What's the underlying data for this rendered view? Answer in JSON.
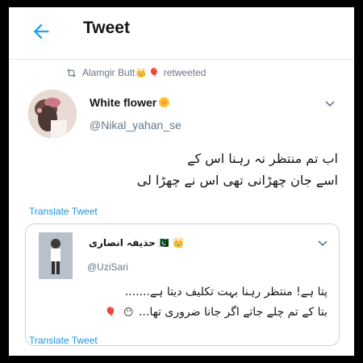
{
  "header": {
    "title": "Tweet",
    "back_icon": "back-arrow-icon",
    "accent_color": "#1da1f2"
  },
  "retweet": {
    "icon": "retweet-icon",
    "user": "Alamgir Butt",
    "emojis": [
      "👑",
      "🎈"
    ],
    "label": "retweeted"
  },
  "tweet": {
    "author_name": "White flower",
    "author_emoji": "🌼",
    "handle": "@Nikal_yahan_se",
    "lines": [
      "اب تم منتظر نہ رہنا اس کے",
      "اسے جان چھڑانی تھی اس نے چھڑا لی"
    ],
    "translate_label": "Translate Tweet"
  },
  "quoted_tweet": {
    "author_name": "حذیفہ انصاری",
    "author_emojis": [
      "🇵🇰",
      "👑"
    ],
    "handle": "@UziSari",
    "lines": [
      "پتا ہے! منتظر رہنا بہت تکلیف دیتا ہے.......",
      "بتا کے تم چلے جاتے اگر جانا ضروری تھا..."
    ],
    "trailing_emojis": [
      "😶",
      "🎈"
    ],
    "translate_label": "Translate Tweet"
  },
  "colors": {
    "text_primary": "#14171a",
    "text_secondary": "#657786",
    "link": "#1b95e0",
    "border": "#ccd6dd"
  }
}
